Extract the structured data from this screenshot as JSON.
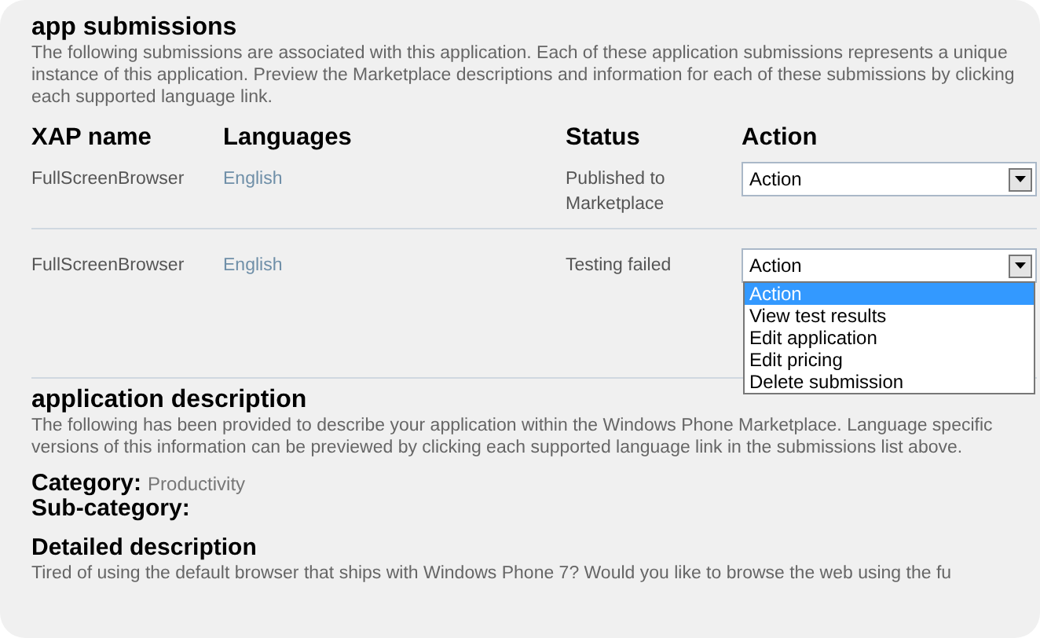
{
  "submissions": {
    "title": "app submissions",
    "description": "The following submissions are associated with this application. Each of these application submissions represents a unique instance of this application. Preview the Marketplace descriptions and information for each of these submissions by clicking each supported language link.",
    "columns": [
      "XAP name",
      "Languages",
      "Status",
      "Action"
    ],
    "rows": [
      {
        "xap_name": "FullScreenBrowser",
        "language": "English",
        "status": "Published to Marketplace",
        "action": {
          "value": "Action",
          "expanded": false
        }
      },
      {
        "xap_name": "FullScreenBrowser",
        "language": "English",
        "status": "Testing failed",
        "action": {
          "value": "Action",
          "expanded": true,
          "options": [
            {
              "label": "Action",
              "selected": true
            },
            {
              "label": "View test results",
              "selected": false
            },
            {
              "label": "Edit application",
              "selected": false
            },
            {
              "label": "Edit pricing",
              "selected": false
            },
            {
              "label": "Delete submission",
              "selected": false
            }
          ]
        }
      }
    ]
  },
  "application_description": {
    "title": "application description",
    "description": "The following has been provided to describe your application within the Windows Phone Marketplace. Language specific versions of this information can be previewed by clicking each supported language link in the submissions list above.",
    "category_label": "Category:",
    "category_value": "Productivity",
    "subcategory_label": "Sub-category:",
    "detailed_description": {
      "title": "Detailed description",
      "text": "Tired of using the default browser that ships with Windows Phone 7? Would you like to browse the web using the fu"
    }
  }
}
